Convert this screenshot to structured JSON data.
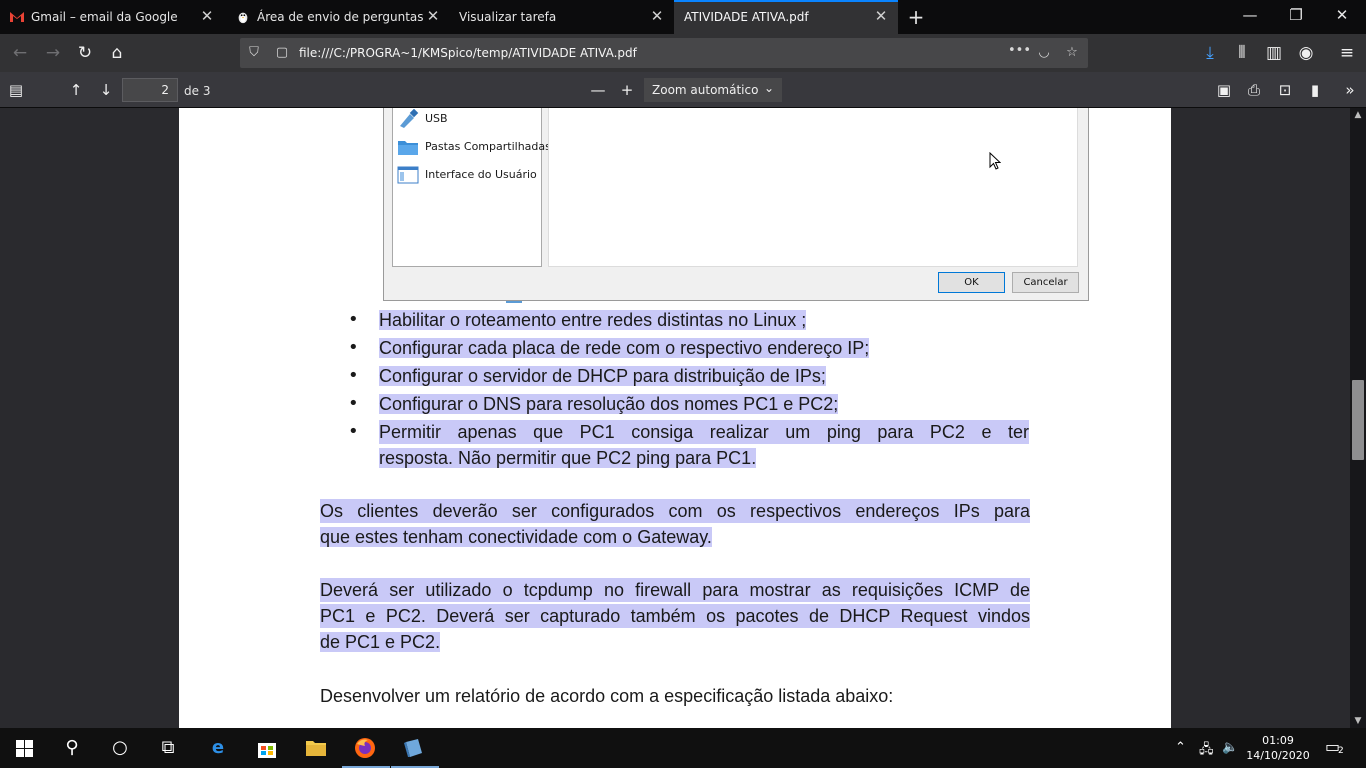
{
  "tabs": [
    {
      "title": "Gmail – email da Google",
      "icon": "gmail-icon"
    },
    {
      "title": "Área de envio de perguntas",
      "icon": "penguin-icon"
    },
    {
      "title": "Visualizar tarefa",
      "icon": "none"
    },
    {
      "title": "ATIVIDADE ATIVA.pdf",
      "icon": "none",
      "active": true
    }
  ],
  "address_bar": {
    "url": "file:///C:/PROGRA~1/KMSpico/temp/ATIVIDADE ATIVA.pdf"
  },
  "pdf_toolbar": {
    "page_number": "2",
    "page_count": "de 3",
    "zoom": "Zoom automático"
  },
  "dialog": {
    "items": [
      {
        "label": "USB",
        "icon": "usb-icon"
      },
      {
        "label": "Pastas Compartilhadas",
        "icon": "shared-folder-icon"
      },
      {
        "label": "Interface do Usuário",
        "icon": "user-interface-icon"
      }
    ],
    "ok_label": "OK",
    "cancel_label": "Cancelar"
  },
  "document": {
    "bullets": [
      {
        "text": "Habilitar o roteamento entre redes distintas no Linux ;"
      },
      {
        "text": "Configurar cada placa de rede com o respectivo endereço IP;"
      },
      {
        "text": "Configurar o servidor de DHCP para distribuição de IPs;"
      },
      {
        "text": "Configurar o DNS para resolução dos nomes PC1 e PC2;"
      },
      {
        "line1": "Permitir apenas que PC1 consiga realizar um ping para PC2 e ter",
        "line2": "resposta. Não permitir que PC2 ping para PC1."
      }
    ],
    "para1": {
      "line1": "Os clientes deverão ser configurados com os respectivos endereços IPs para",
      "line2": "que estes tenham conectividade com o Gateway."
    },
    "para2": {
      "line1": "Deverá ser utilizado o tcpdump no firewall para mostrar as requisições ICMP de",
      "line2": "PC1 e PC2. Deverá ser capturado também os pacotes de DHCP Request vindos",
      "line3": "de PC1 e PC2."
    },
    "para3": "Desenvolver um relatório de acordo com a especificação listada abaixo:"
  },
  "taskbar": {
    "time": "01:09",
    "date": "14/10/2020",
    "notification_count": "2"
  },
  "colors": {
    "accent": "#0a84ff",
    "highlight": "#c9c9f7"
  }
}
